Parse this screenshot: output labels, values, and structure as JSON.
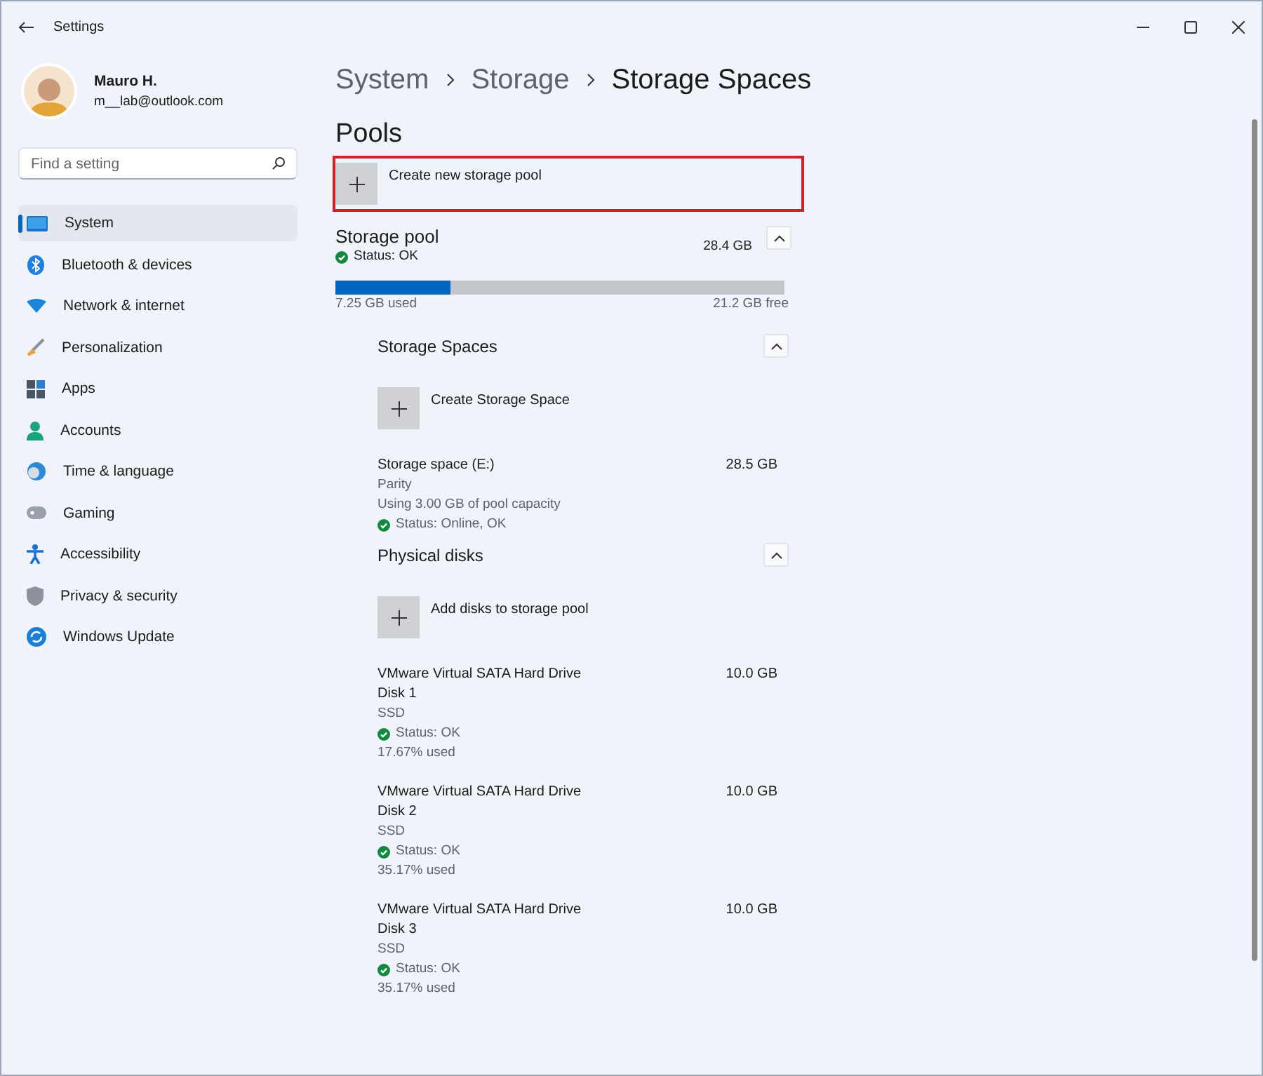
{
  "window": {
    "title": "Settings"
  },
  "profile": {
    "name": "Mauro H.",
    "email": "m__lab@outlook.com"
  },
  "search": {
    "placeholder": "Find a setting"
  },
  "sidebar": {
    "items": [
      {
        "label": "System",
        "selected": true
      },
      {
        "label": "Bluetooth & devices",
        "selected": false
      },
      {
        "label": "Network & internet",
        "selected": false
      },
      {
        "label": "Personalization",
        "selected": false
      },
      {
        "label": "Apps",
        "selected": false
      },
      {
        "label": "Accounts",
        "selected": false
      },
      {
        "label": "Time & language",
        "selected": false
      },
      {
        "label": "Gaming",
        "selected": false
      },
      {
        "label": "Accessibility",
        "selected": false
      },
      {
        "label": "Privacy & security",
        "selected": false
      },
      {
        "label": "Windows Update",
        "selected": false
      }
    ]
  },
  "breadcrumb": [
    {
      "label": "System",
      "selected": false
    },
    {
      "label": "Storage",
      "selected": false
    },
    {
      "label": "Storage Spaces",
      "selected": true
    }
  ],
  "heading": "Pools",
  "create_pool": {
    "label": "Create new storage pool",
    "highlighted": true
  },
  "pool": {
    "name": "Storage pool",
    "size": "28.4 GB",
    "status": "Status: OK",
    "expanded": true,
    "level": 0.255,
    "used": "7.25 GB used",
    "free": "21.2 GB free",
    "sections": [
      {
        "title": "Storage Spaces",
        "expanded": true,
        "add_label": "Create Storage Space",
        "items": [
          {
            "name": "Storage space (E:)",
            "size": "28.5 GB",
            "lines": [
              {
                "text": "Parity",
                "kind": "plain"
              },
              {
                "text": "Using 3.00 GB of pool capacity",
                "kind": "plain"
              },
              {
                "text": "Status: Online, OK",
                "kind": "status"
              }
            ]
          }
        ]
      },
      {
        "title": "Physical disks",
        "expanded": true,
        "add_label": "Add disks to storage pool",
        "items": [
          {
            "name": "VMware Virtual SATA Hard Drive",
            "size": "10.0 GB",
            "lines": [
              {
                "text": "Disk 1",
                "kind": "name"
              },
              {
                "text": "SSD",
                "kind": "plain"
              },
              {
                "text": "Status: OK",
                "kind": "status"
              },
              {
                "text": "17.67% used",
                "kind": "plain"
              }
            ]
          },
          {
            "name": "VMware Virtual SATA Hard Drive",
            "size": "10.0 GB",
            "lines": [
              {
                "text": "Disk 2",
                "kind": "name"
              },
              {
                "text": "SSD",
                "kind": "plain"
              },
              {
                "text": "Status: OK",
                "kind": "status"
              },
              {
                "text": "35.17% used",
                "kind": "plain"
              }
            ]
          },
          {
            "name": "VMware Virtual SATA Hard Drive",
            "size": "10.0 GB",
            "lines": [
              {
                "text": "Disk 3",
                "kind": "name"
              },
              {
                "text": "SSD",
                "kind": "plain"
              },
              {
                "text": "Status: OK",
                "kind": "status"
              },
              {
                "text": "35.17% used",
                "kind": "plain"
              }
            ]
          }
        ]
      }
    ]
  }
}
